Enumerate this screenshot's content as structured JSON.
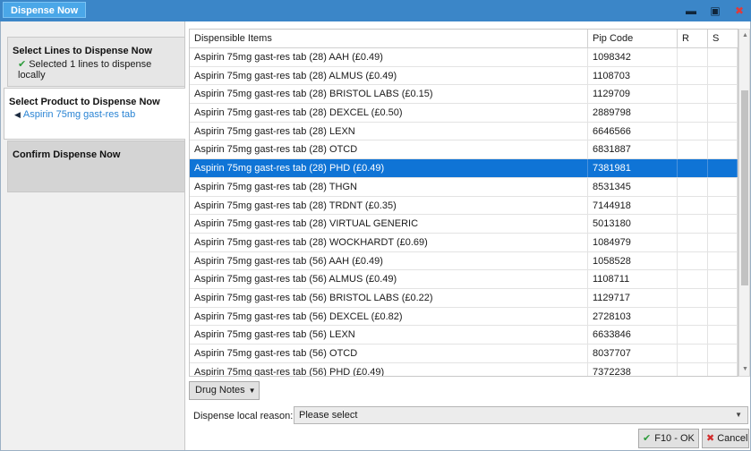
{
  "window": {
    "title": "Dispense Now",
    "minimize_icon": "minimize-icon",
    "maximize_icon": "maximize-icon",
    "close_icon": "close-icon"
  },
  "steps": [
    {
      "title": "Select Lines to Dispense Now",
      "subtitle": "Selected 1 lines to dispense locally",
      "icon": "checkmark-icon"
    },
    {
      "title": "Select Product to Dispense Now",
      "subtitle": "Aspirin 75mg gast-res tab",
      "icon": "triangle-left-icon"
    },
    {
      "title": "Confirm Dispense Now"
    }
  ],
  "grid": {
    "columns": [
      "Dispensible Items",
      "Pip Code",
      "R",
      "S"
    ],
    "selected_index": 6,
    "rows": [
      {
        "name": "Aspirin 75mg gast-res tab (28) AAH (£0.49)",
        "pip": "1098342",
        "r": "",
        "s": ""
      },
      {
        "name": "Aspirin 75mg gast-res tab (28) ALMUS (£0.49)",
        "pip": "1108703",
        "r": "",
        "s": ""
      },
      {
        "name": "Aspirin 75mg gast-res tab (28) BRISTOL LABS (£0.15)",
        "pip": "1129709",
        "r": "",
        "s": ""
      },
      {
        "name": "Aspirin 75mg gast-res tab (28) DEXCEL (£0.50)",
        "pip": "2889798",
        "r": "",
        "s": ""
      },
      {
        "name": "Aspirin 75mg gast-res tab (28) LEXN",
        "pip": "6646566",
        "r": "",
        "s": ""
      },
      {
        "name": "Aspirin 75mg gast-res tab (28) OTCD",
        "pip": "6831887",
        "r": "",
        "s": ""
      },
      {
        "name": "Aspirin 75mg gast-res tab (28) PHD (£0.49)",
        "pip": "7381981",
        "r": "",
        "s": ""
      },
      {
        "name": "Aspirin 75mg gast-res tab (28) THGN",
        "pip": "8531345",
        "r": "",
        "s": ""
      },
      {
        "name": "Aspirin 75mg gast-res tab (28) TRDNT (£0.35)",
        "pip": "7144918",
        "r": "",
        "s": ""
      },
      {
        "name": "Aspirin 75mg gast-res tab (28) VIRTUAL GENERIC",
        "pip": "5013180",
        "r": "",
        "s": ""
      },
      {
        "name": "Aspirin 75mg gast-res tab (28) WOCKHARDT (£0.69)",
        "pip": "1084979",
        "r": "",
        "s": ""
      },
      {
        "name": "Aspirin 75mg gast-res tab (56) AAH (£0.49)",
        "pip": "1058528",
        "r": "",
        "s": ""
      },
      {
        "name": "Aspirin 75mg gast-res tab (56) ALMUS (£0.49)",
        "pip": "1108711",
        "r": "",
        "s": ""
      },
      {
        "name": "Aspirin 75mg gast-res tab (56) BRISTOL LABS (£0.22)",
        "pip": "1129717",
        "r": "",
        "s": ""
      },
      {
        "name": "Aspirin 75mg gast-res tab (56) DEXCEL (£0.82)",
        "pip": "2728103",
        "r": "",
        "s": ""
      },
      {
        "name": "Aspirin 75mg gast-res tab (56) LEXN",
        "pip": "6633846",
        "r": "",
        "s": ""
      },
      {
        "name": "Aspirin 75mg gast-res tab (56) OTCD",
        "pip": "8037707",
        "r": "",
        "s": ""
      },
      {
        "name": "Aspirin 75mg gast-res tab (56) PHD (£0.49)",
        "pip": "7372238",
        "r": "",
        "s": ""
      }
    ]
  },
  "drug_notes_label": "Drug Notes",
  "reason": {
    "label": "Dispense local reason:",
    "value": "Please select"
  },
  "buttons": {
    "ok": "F10 - OK",
    "cancel": "Cancel"
  },
  "colors": {
    "titlebar": "#3b86c8",
    "selected_row": "#0f74d6",
    "link": "#2a84d4",
    "check": "#2e9c3c",
    "cancel": "#d22d2d"
  }
}
